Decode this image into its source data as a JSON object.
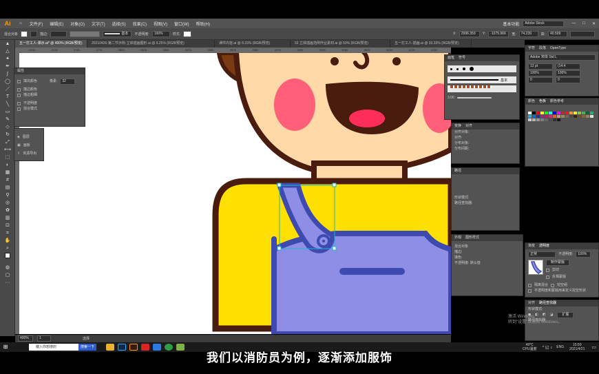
{
  "app": {
    "logo": "Ai",
    "menus": [
      "文件(F)",
      "编辑(E)",
      "对象(O)",
      "文字(T)",
      "选择(S)",
      "效果(C)",
      "视图(V)",
      "窗口(W)",
      "帮助(H)"
    ],
    "workspace": "基本功能",
    "search_placeholder": "Adobe Stock"
  },
  "control_bar": {
    "selection_label": "混合对象",
    "stroke_label": "描边:",
    "brush_label": "基本",
    "opacity_label": "不透明度:",
    "opacity_value": "100%",
    "style_label": "样式:",
    "x_value": "2996.359",
    "y_value": "-1075.966",
    "w_value": "74.239",
    "h_value": "40.509"
  },
  "tabs": [
    {
      "label": "五一打工人·课示.ai* @ 400% (RGB/预览)",
      "active": true
    },
    {
      "label": "20210426·第二节示例·立体插画图形.ai @ 6.25% (RGB/预览)",
      "active": false
    },
    {
      "label": "课件内容.ai @ 8.33% (RGB/预览)",
      "active": false
    },
    {
      "label": "02 立体插画范例作业素材.ai @ 50% (RGB/预览)",
      "active": false
    },
    {
      "label": "五一打工人·插画.ai @ 33.33% (RGB/预览)",
      "active": false
    }
  ],
  "ruler_ticks": [
    "2700",
    "2725",
    "2750",
    "2775",
    "2800",
    "2825",
    "2850",
    "2875",
    "2900",
    "2925",
    "2950",
    "2975",
    "3000",
    "3025",
    "3050",
    "3075",
    "3100",
    "3125",
    "3150"
  ],
  "appearance_panel": {
    "title": "属性",
    "rows": [
      "填充颜色",
      "描边颜色",
      "描边粗细",
      "不透明度",
      "混合模式"
    ],
    "size_label": "像素:",
    "size_value": "32"
  },
  "layers_flyout": {
    "items": [
      "图层",
      "画板",
      "资源导出"
    ]
  },
  "brushes_panel": {
    "tabs": [
      "画笔",
      "符号"
    ],
    "brush_name": "基本",
    "stroke_size": "3.00"
  },
  "transform_panel": {
    "tabs": [
      "变换",
      "对齐"
    ],
    "rows": [
      "对齐对象:",
      "对齐:",
      "分布对象:",
      "分布间距:"
    ]
  },
  "pathfinder": {
    "title": "路径",
    "rows": [
      "形状模式:",
      "路径查找器:"
    ]
  },
  "appearance2": {
    "tabs": [
      "外观",
      "图形样式"
    ],
    "rows": [
      "混合对象",
      "描边:",
      "填色:",
      "不透明度: 默认值"
    ]
  },
  "character_panel": {
    "tabs": [
      "字符",
      "段落",
      "OpenType"
    ],
    "font": "Adobe 宋体 Std L",
    "size": "12 pt",
    "leading": "(14.4",
    "scale_h": "100%",
    "scale_v": "100%",
    "tracking": "0",
    "kerning": "0"
  },
  "swatches_panel": {
    "tabs": [
      "颜色",
      "色板",
      "颜色参考"
    ],
    "colors": [
      "#ffffff",
      "#000000",
      "#ff0000",
      "#ffff00",
      "#00ff00",
      "#00ffff",
      "#0000ff",
      "#ff00ff",
      "#c1272d",
      "#ed1c24",
      "#f7931e",
      "#fcee21",
      "#8cc63f",
      "#39b54a",
      "#006837",
      "#22b573",
      "#29abe2",
      "#0071bc",
      "#2e3192",
      "#93278f",
      "#d4145a",
      "#ed1e79",
      "#f15a24",
      "#c69c6d",
      "#998675",
      "#736357",
      "#534741",
      "#42210b",
      "#754c24",
      "#8c6239",
      "#a67c52",
      "#e6e6e6",
      "#cccccc",
      "#b3b3b3",
      "#999999",
      "#808080",
      "#666666",
      "#4d4d4d",
      "#333333",
      "#1a1a1a"
    ]
  },
  "transparency_panel": {
    "tabs": [
      "渐变",
      "透明度"
    ],
    "mode": "正常",
    "opacity_label": "不透明度:",
    "opacity_value": "100%",
    "make_mask": "制作蒙版",
    "clip": "剪切",
    "invert": "反相蒙版",
    "isolate": "隔离混合",
    "knockout": "挖空组",
    "mask_text": "不透明度和蒙版用来定义挖空形状"
  },
  "pathfinder2": {
    "tabs": [
      "对齐",
      "路径查找器"
    ],
    "shape_modes": "形状模式:",
    "pathfinders": "路径查找器:",
    "expand": "扩展"
  },
  "status_bar": {
    "zoom": "400%",
    "page": "1",
    "tool": "选择"
  },
  "watermark": {
    "line1": "激活 Windows",
    "line2": "转到\"设置\"以激活 Windows。"
  },
  "taskbar": {
    "search_placeholder": "键入你想搜的",
    "search_button": "搜索一下",
    "temp": "49°C",
    "temp_label": "CPU温度",
    "lang": "ENG",
    "time": "15:50",
    "date": "2021/4/21"
  },
  "subtitle": "我们以消防员为例，逐渐添加服饰",
  "colors": {
    "outline": "#4a1c0d",
    "hair": "#7a3b12",
    "skin": "#ffd9a8",
    "cheek": "#ff5f78",
    "tongue": "#ff2d5a",
    "shirt": "#ffe000",
    "overall": "#8f8ee6",
    "overall_dark": "#3e4ab0",
    "selection": "#18b5c9"
  }
}
